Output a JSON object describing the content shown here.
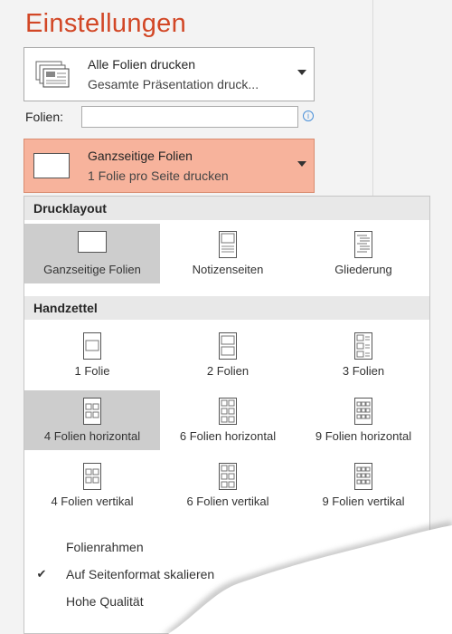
{
  "settings": {
    "title": "Einstellungen"
  },
  "print_what": {
    "line1": "Alle Folien drucken",
    "line2": "Gesamte Präsentation druck..."
  },
  "slides": {
    "label": "Folien:",
    "value": ""
  },
  "layout_dropdown": {
    "line1": "Ganzseitige Folien",
    "line2": "1 Folie pro Seite drucken"
  },
  "menu": {
    "section_layout": "Drucklayout",
    "layouts": [
      {
        "label": "Ganzseitige Folien",
        "selected": true
      },
      {
        "label": "Notizenseiten",
        "selected": false
      },
      {
        "label": "Gliederung",
        "selected": false
      }
    ],
    "section_handouts": "Handzettel",
    "handouts": [
      {
        "label": "1 Folie",
        "selected": false
      },
      {
        "label": "2 Folien",
        "selected": false
      },
      {
        "label": "3 Folien",
        "selected": false
      },
      {
        "label": "4 Folien horizontal",
        "selected": true
      },
      {
        "label": "6 Folien horizontal",
        "selected": false
      },
      {
        "label": "9 Folien horizontal",
        "selected": false
      },
      {
        "label": "4 Folien vertikal",
        "selected": false
      },
      {
        "label": "6 Folien vertikal",
        "selected": false
      },
      {
        "label": "9 Folien vertikal",
        "selected": false
      }
    ],
    "options": [
      {
        "label": "Folienrahmen",
        "checked": false
      },
      {
        "label": "Auf Seitenformat skalieren",
        "checked": true
      },
      {
        "label": "Hohe Qualität",
        "checked": false
      }
    ]
  },
  "colors": {
    "accent": "#d24726",
    "highlight": "#f7b39c",
    "selected_tile": "#cdcdcd"
  }
}
